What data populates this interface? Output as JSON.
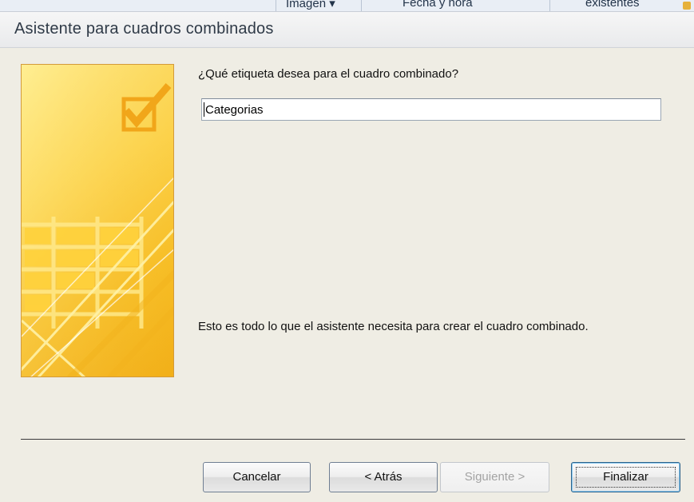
{
  "background_app": {
    "ribbon_fragments": [
      "Imagen ▾",
      "Fecha y hora",
      "existentes"
    ]
  },
  "dialog": {
    "title": "Asistente para cuadros combinados",
    "question": "¿Qué etiqueta desea para el cuadro combinado?",
    "label_input": {
      "value": "Categorias",
      "placeholder": ""
    },
    "info_text": "Esto es todo lo que el asistente necesita para crear el cuadro combinado.",
    "buttons": {
      "cancel": "Cancelar",
      "back": "< Atrás",
      "next": "Siguiente >",
      "finish": "Finalizar"
    },
    "button_state": {
      "next_enabled": false,
      "default_button": "finish"
    }
  },
  "colors": {
    "banner_yellow": "#ffd94a",
    "banner_orange": "#f2b11a",
    "dialog_background": "#efede4",
    "disabled_text": "#a3a3a3"
  },
  "icons": {
    "banner_checkbox": "checkbox-checked-icon"
  }
}
